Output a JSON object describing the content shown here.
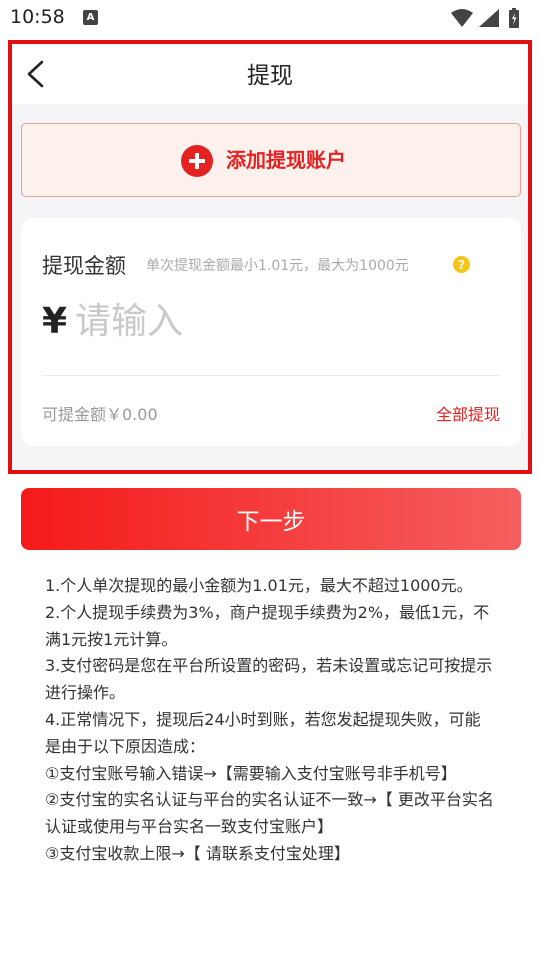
{
  "status_bar": {
    "time": "10:58",
    "notification_icon": "A"
  },
  "header": {
    "title": "提现"
  },
  "add_account": {
    "label": "添加提现账户"
  },
  "amount_card": {
    "label": "提现金额",
    "hint": "单次提现金额最小1.01元，最大为1000元",
    "currency": "¥",
    "input_placeholder": "请输入",
    "input_value": "",
    "available_text": "可提金额￥0.00",
    "withdraw_all_label": "全部提现"
  },
  "next_button": {
    "label": "下一步"
  },
  "notes": [
    "1.个人单次提现的最小金额为1.01元，最大不超过1000元。",
    "2.个人提现手续费为3%，商户提现手续费为2%，最低1元，不满1元按1元计算。",
    "3.支付密码是您在平台所设置的密码，若未设置或忘记可按提示进行操作。",
    "4.正常情况下，提现后24小时到账，若您发起提现失败，可能是由于以下原因造成：",
    "①支付宝账号输入错误→【需要输入支付宝账号非手机号】",
    "②支付宝的实名认证与平台的实名认证不一致→【 更改平台实名认证或使用与平台实名一致支付宝账户】",
    "③支付宝收款上限→【 请联系支付宝处理】"
  ],
  "colors": {
    "accent": "#e52222",
    "highlight_border": "#e01010",
    "add_account_bg": "#fdf1ee",
    "button_gradient_start": "#f51a1a",
    "button_gradient_end": "#f55f5f",
    "help_icon": "#f5c518"
  },
  "icons": {
    "back": "chevron-left-icon",
    "add": "plus-circle-icon",
    "help": "question-circle-icon",
    "wifi": "wifi-icon",
    "signal": "signal-icon",
    "battery": "battery-icon"
  }
}
